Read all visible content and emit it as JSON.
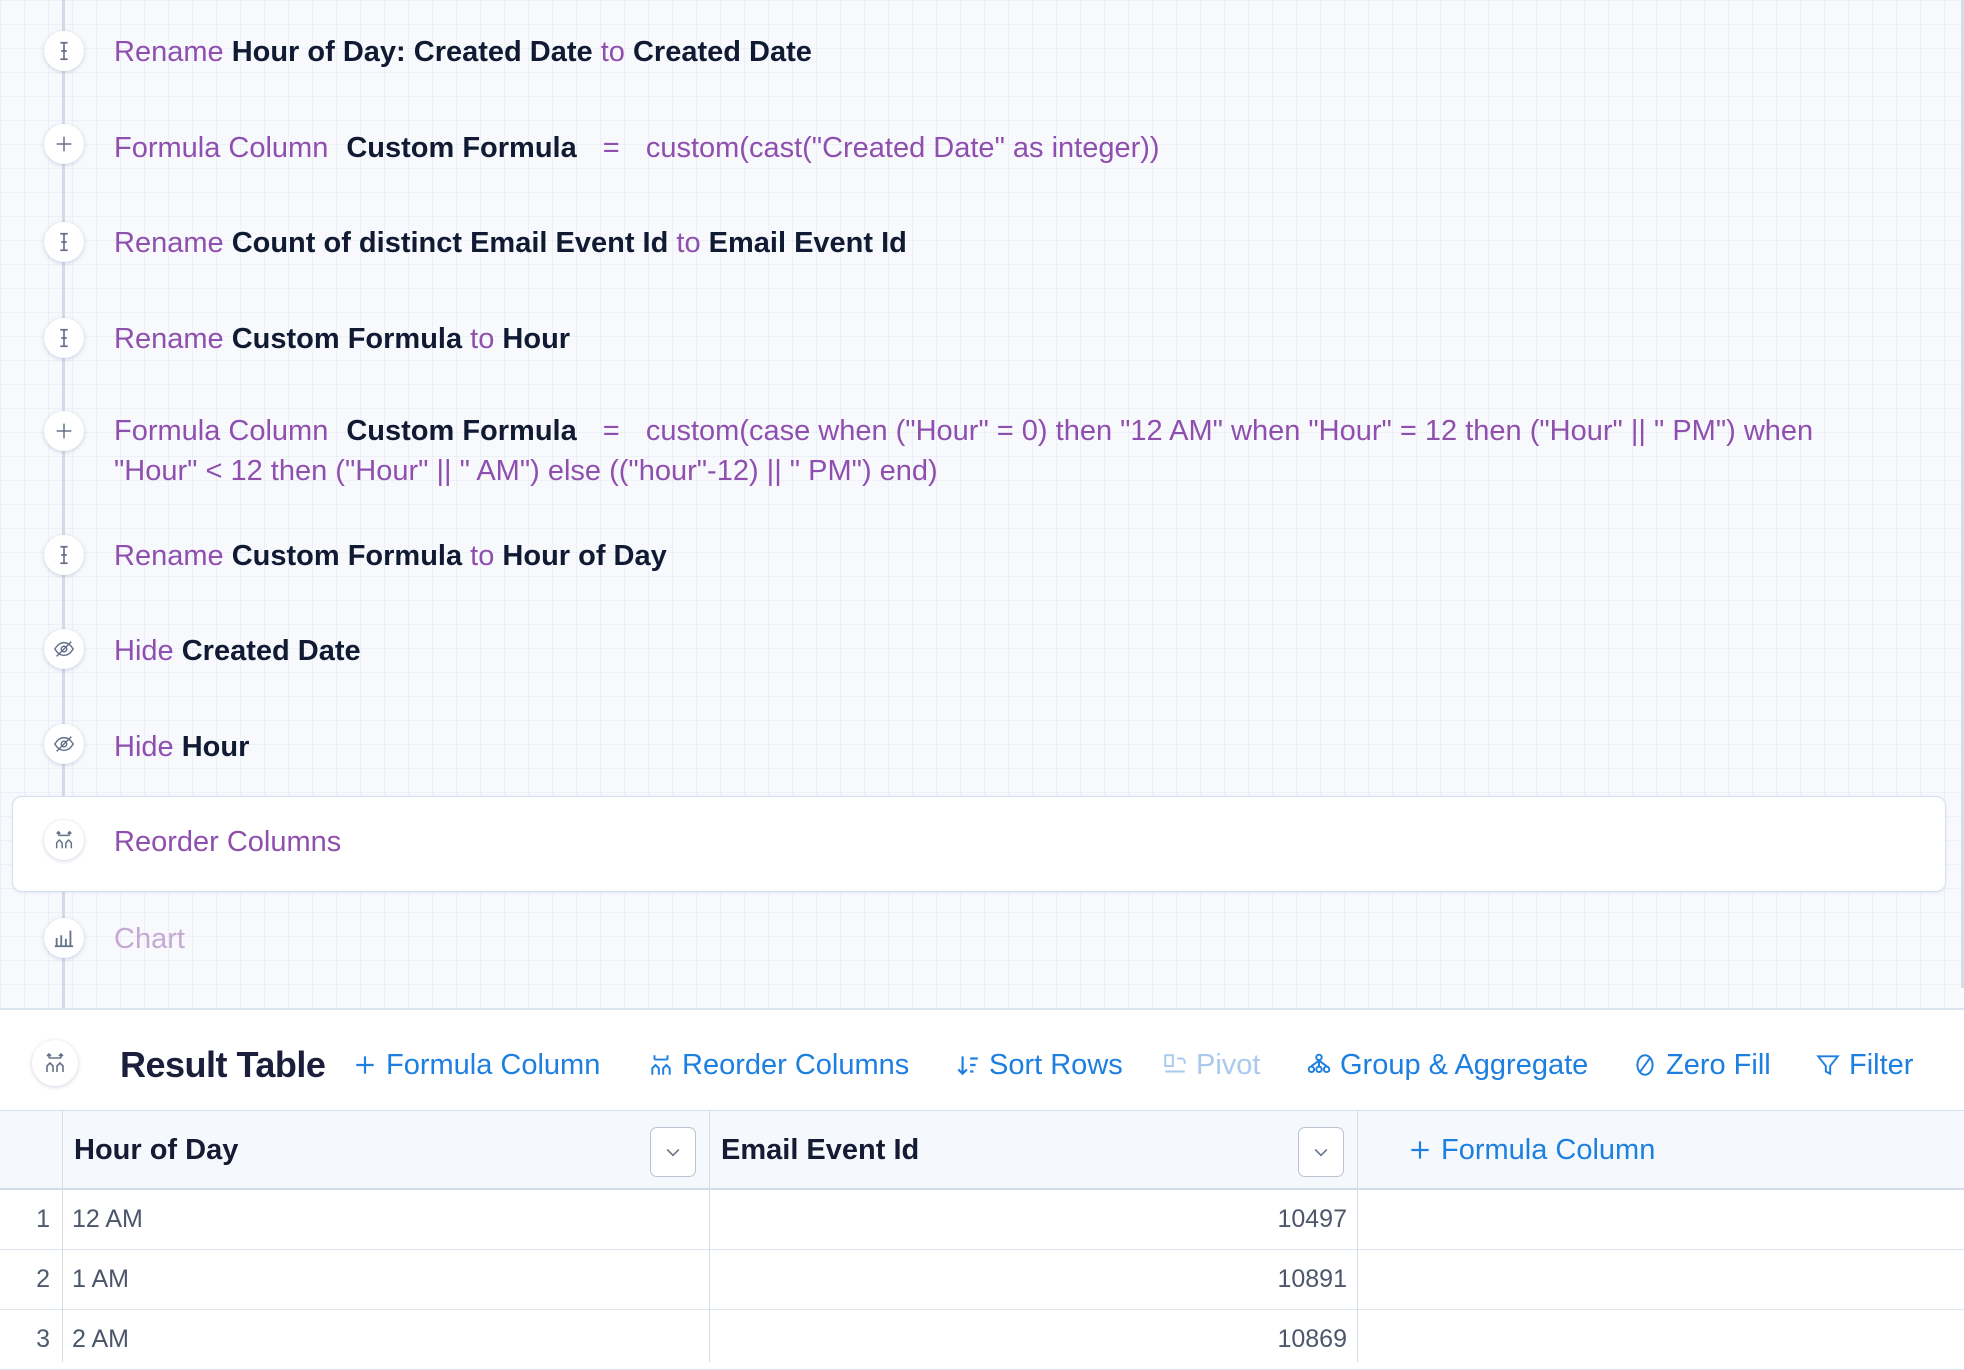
{
  "steps": [
    {
      "icon": "rename-cursor-icon",
      "parts": [
        {
          "t": "Rename",
          "b": false
        },
        {
          "t": " ",
          "b": false
        },
        {
          "t": "Hour of Day: Created Date",
          "b": true
        },
        {
          "t": " to ",
          "b": false
        },
        {
          "t": "Created Date",
          "b": true
        }
      ]
    },
    {
      "icon": "plus-icon",
      "parts": [
        {
          "t": "Formula Column",
          "b": false
        },
        {
          "t": "  ",
          "b": false
        },
        {
          "t": "Custom Formula",
          "b": true
        },
        {
          "t": "  =  ",
          "b": false
        },
        {
          "t": "custom(cast(\"Created Date\" as integer))",
          "b": false
        }
      ]
    },
    {
      "icon": "rename-cursor-icon",
      "parts": [
        {
          "t": "Rename",
          "b": false
        },
        {
          "t": " ",
          "b": false
        },
        {
          "t": "Count of distinct Email Event Id",
          "b": true
        },
        {
          "t": " to ",
          "b": false
        },
        {
          "t": "Email Event Id",
          "b": true
        }
      ]
    },
    {
      "icon": "rename-cursor-icon",
      "parts": [
        {
          "t": "Rename",
          "b": false
        },
        {
          "t": " ",
          "b": false
        },
        {
          "t": "Custom Formula",
          "b": true
        },
        {
          "t": " to ",
          "b": false
        },
        {
          "t": "Hour",
          "b": true
        }
      ]
    },
    {
      "icon": "plus-icon",
      "parts": [
        {
          "t": "Formula Column",
          "b": false
        },
        {
          "t": "  ",
          "b": false
        },
        {
          "t": "Custom Formula",
          "b": true
        },
        {
          "t": "  =  ",
          "b": false
        },
        {
          "t": "custom(case when (\"Hour\" = 0) then \"12 AM\" when \"Hour\" = 12 then (\"Hour\" || \" PM\") when \"Hour\" < 12 then (\"Hour\" || \" AM\") else ((\"hour\"-12) || \" PM\") end)",
          "b": false
        }
      ]
    },
    {
      "icon": "rename-cursor-icon",
      "parts": [
        {
          "t": "Rename",
          "b": false
        },
        {
          "t": " ",
          "b": false
        },
        {
          "t": "Custom Formula",
          "b": true
        },
        {
          "t": " to ",
          "b": false
        },
        {
          "t": "Hour of Day",
          "b": true
        }
      ]
    },
    {
      "icon": "eye-slash-icon",
      "parts": [
        {
          "t": "Hide",
          "b": false
        },
        {
          "t": " ",
          "b": false
        },
        {
          "t": "Created Date",
          "b": true
        }
      ]
    },
    {
      "icon": "eye-slash-icon",
      "parts": [
        {
          "t": "Hide",
          "b": false
        },
        {
          "t": " ",
          "b": false
        },
        {
          "t": "Hour",
          "b": true
        }
      ]
    },
    {
      "icon": "reorder-columns-icon",
      "parts": [
        {
          "t": "Reorder Columns",
          "b": false
        }
      ]
    },
    {
      "icon": "bar-chart-icon",
      "parts": [
        {
          "t": "Chart",
          "b": false
        }
      ]
    }
  ],
  "result": {
    "title": "Result Table",
    "toolbar": {
      "formula_column": "Formula Column",
      "reorder_columns": "Reorder Columns",
      "sort_rows": "Sort Rows",
      "pivot": "Pivot",
      "group_aggregate": "Group & Aggregate",
      "zero_fill": "Zero Fill",
      "filter": "Filter"
    },
    "columns": [
      "Hour of Day",
      "Email Event Id"
    ],
    "add_column_label": "Formula Column",
    "rows": [
      {
        "num": "1",
        "hour": "12 AM",
        "count": "10497"
      },
      {
        "num": "2",
        "hour": "1 AM",
        "count": "10891"
      },
      {
        "num": "3",
        "hour": "2 AM",
        "count": "10869"
      }
    ]
  },
  "colors": {
    "accent": "#1d7fe0",
    "step_keyword": "#8f4fae",
    "step_bold": "#111a33"
  }
}
